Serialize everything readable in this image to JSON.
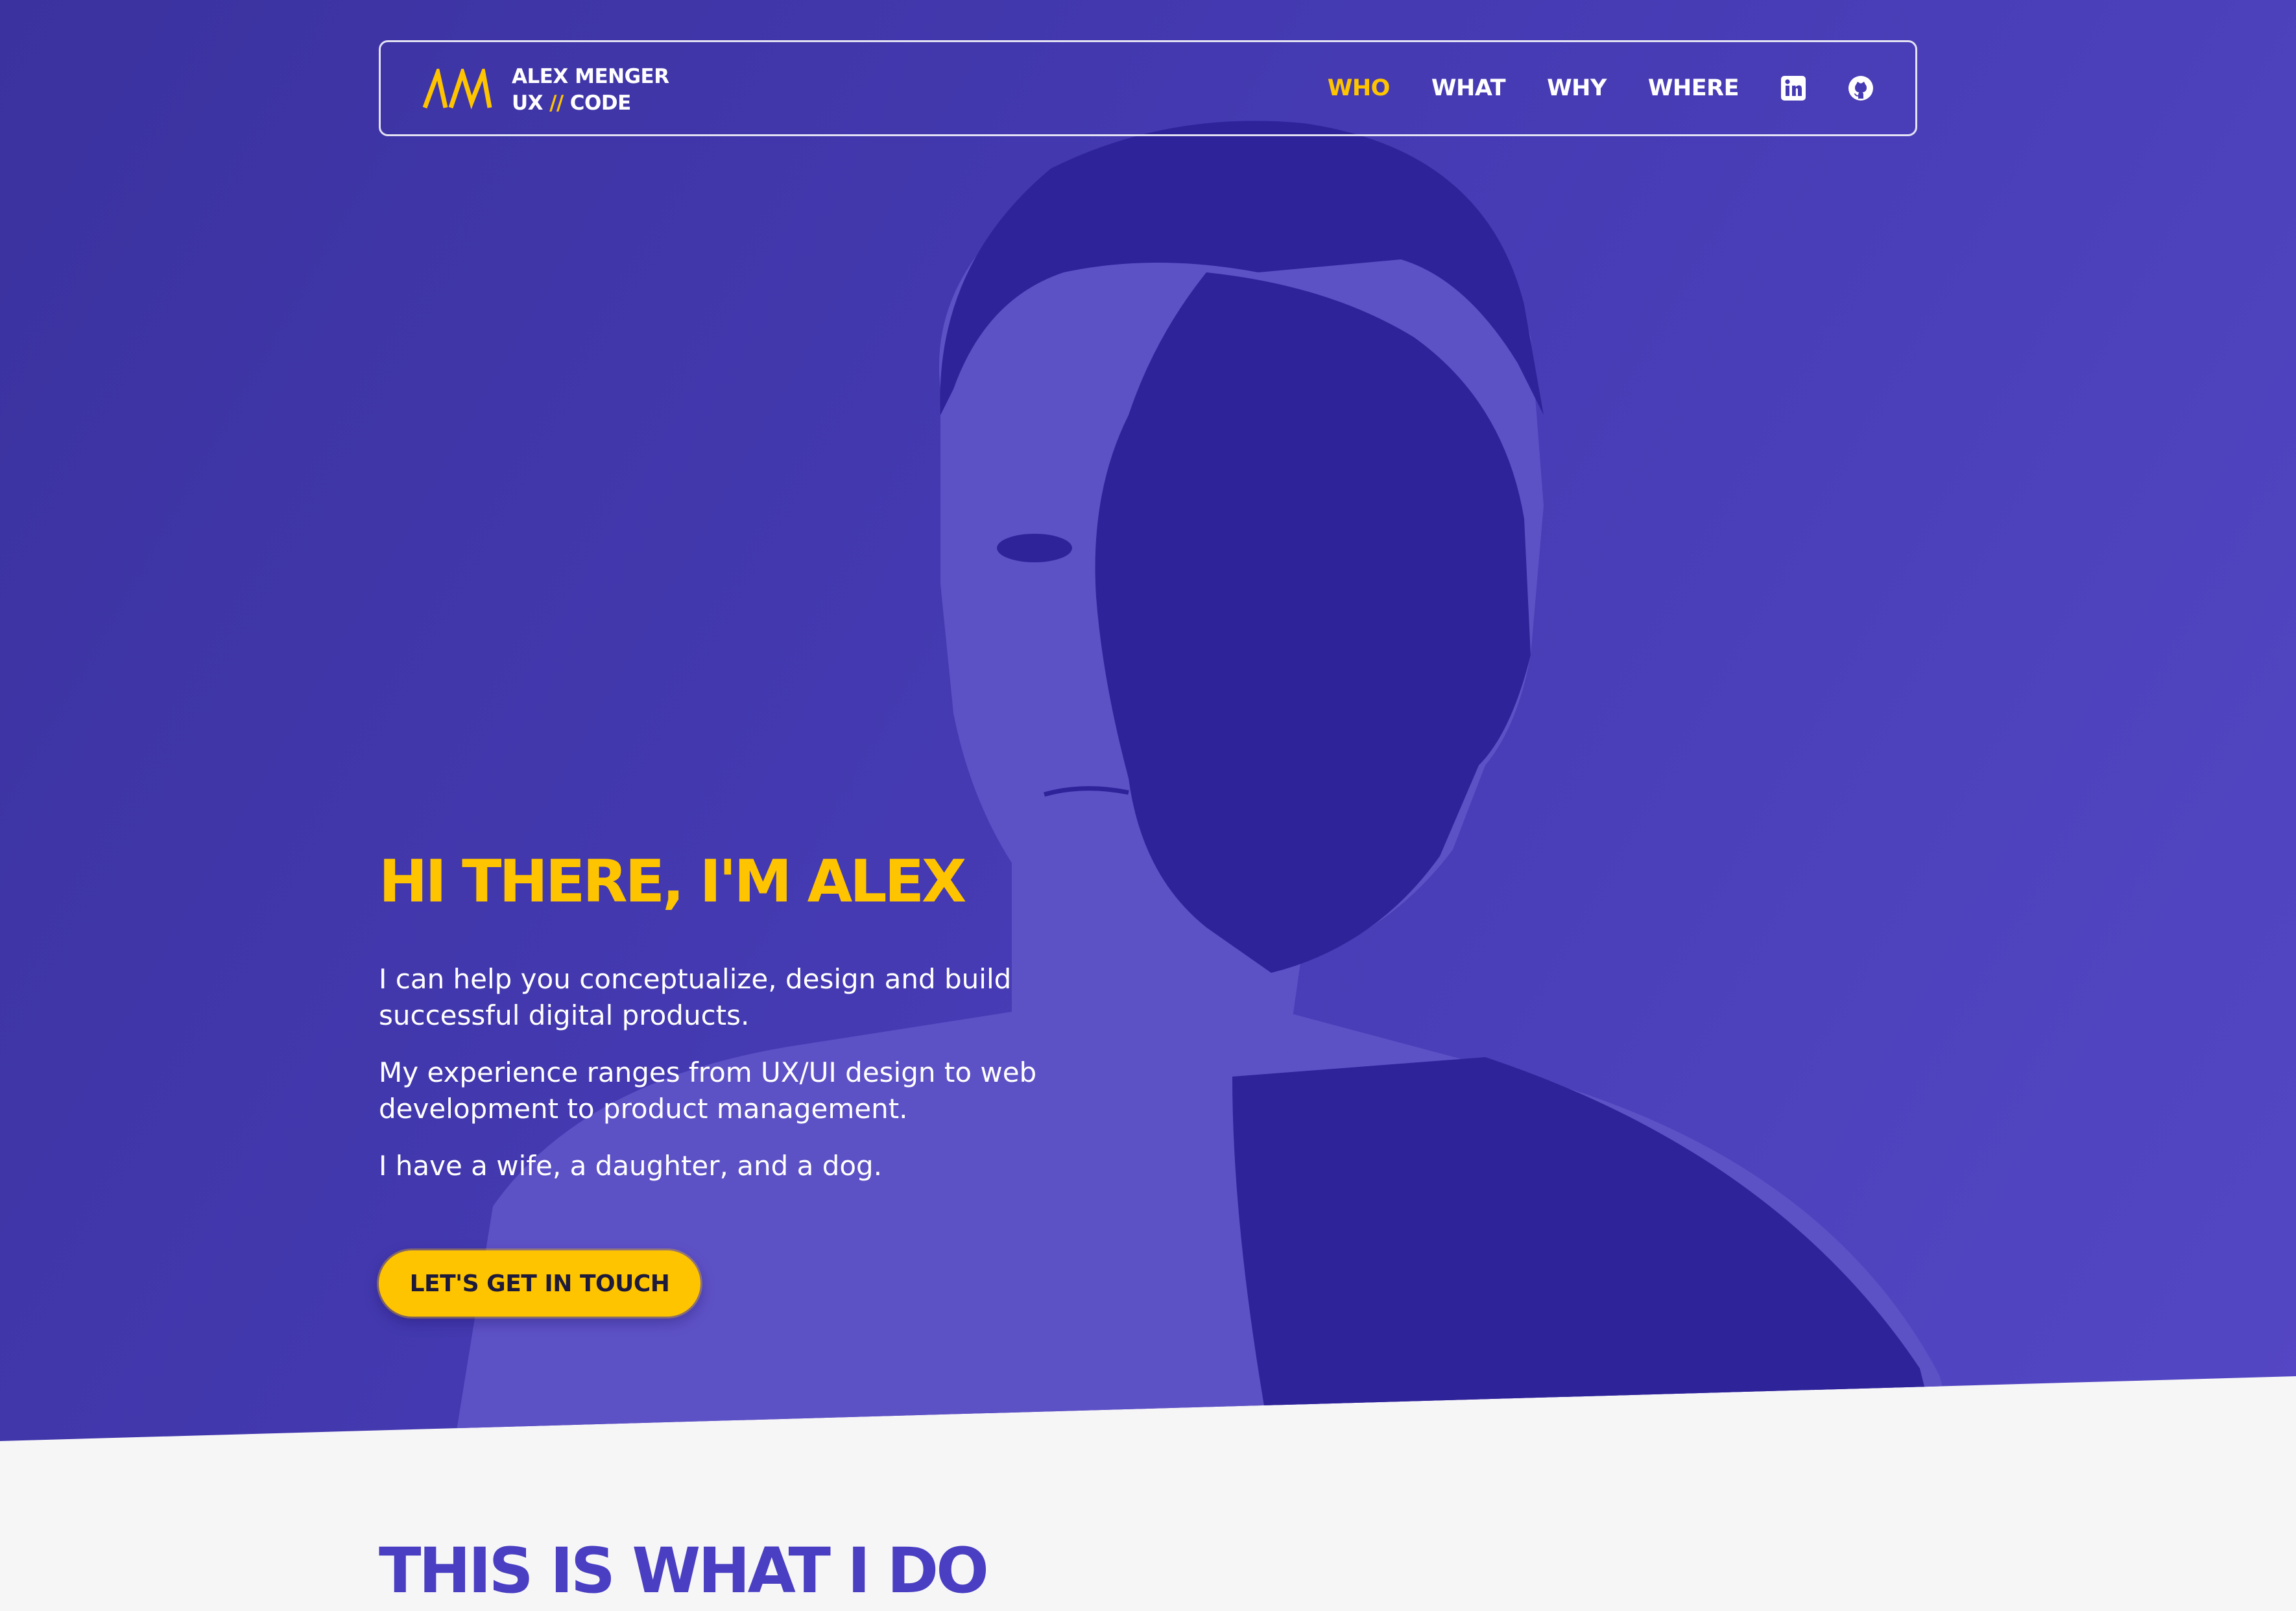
{
  "brand": {
    "logo_text": "AM",
    "name": "ALEX MENGER",
    "tagline_left": "UX",
    "tagline_sep": "//",
    "tagline_right": "CODE"
  },
  "nav": {
    "items": [
      {
        "label": "WHO",
        "active": true
      },
      {
        "label": "WHAT",
        "active": false
      },
      {
        "label": "WHY",
        "active": false
      },
      {
        "label": "WHERE",
        "active": false
      }
    ],
    "icons": [
      "linkedin-icon",
      "github-icon"
    ]
  },
  "hero": {
    "title": "HI THERE, I'M ALEX",
    "paragraphs": [
      "I can help you conceptualize, design and build successful digital products.",
      "My experience ranges from UX/UI design to web development to product management.",
      "I have a wife, a daughter, and a dog."
    ],
    "cta_label": "LET'S GET IN TOUCH"
  },
  "section": {
    "title": "THIS IS WHAT I DO"
  },
  "colors": {
    "hero_bg": "#453ab2",
    "accent": "#ffc400",
    "section_bg": "#f6f6f7",
    "section_title": "#4a3fc2",
    "portrait_light": "#5d51c6",
    "portrait_dark": "#2e2399"
  }
}
